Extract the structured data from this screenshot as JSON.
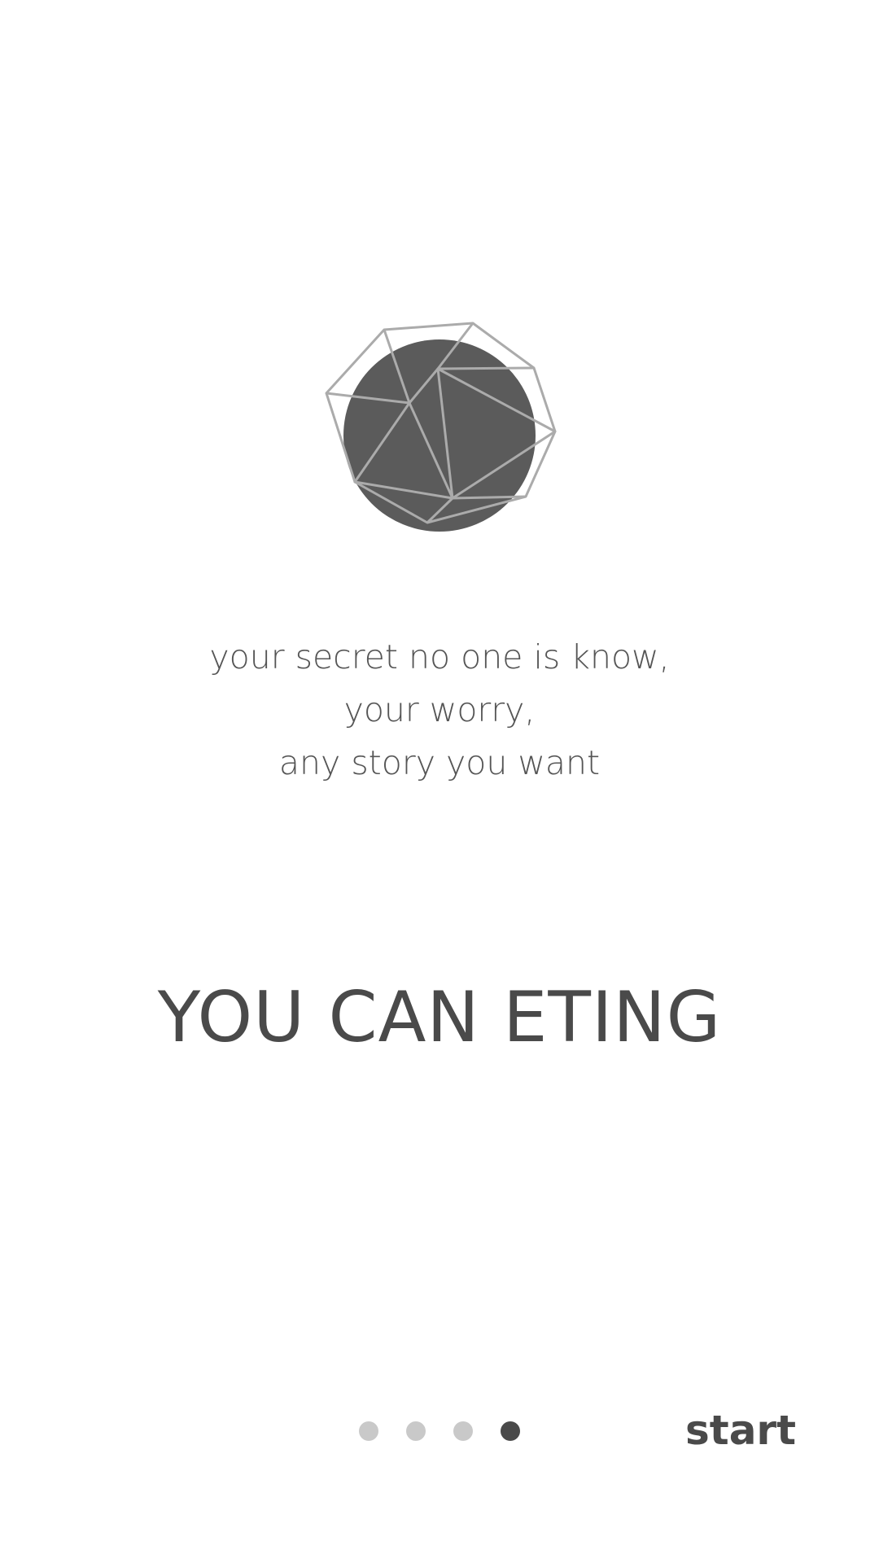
{
  "logo": {
    "icon": "geometric-planet-icon"
  },
  "tagline": {
    "line1": "your secret no one is know,",
    "line2": "your worry,",
    "line3": "any story you want"
  },
  "headline": "YOU CAN ETING",
  "pager": {
    "total": 4,
    "active_index": 3
  },
  "start_label": "start",
  "colors": {
    "text": "#4a4a4a",
    "dot_inactive": "#c9c9c9",
    "dot_active": "#4a4a4a",
    "logo_fill": "#5b5b5b",
    "logo_line": "#a8a8a8"
  }
}
